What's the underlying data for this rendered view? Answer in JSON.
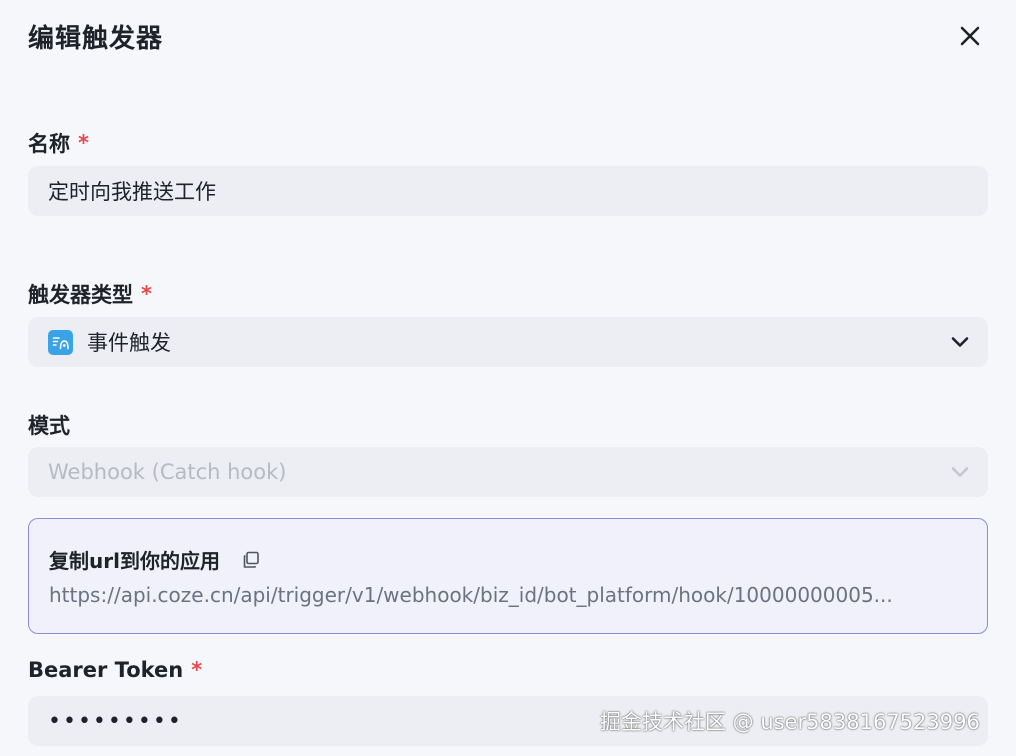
{
  "dialog": {
    "title": "编辑触发器"
  },
  "name_field": {
    "label": "名称",
    "required_mark": "*",
    "value": "定时向我推送工作"
  },
  "trigger_type": {
    "label": "触发器类型",
    "required_mark": "*",
    "value": "事件触发",
    "icon": "event-trigger-icon"
  },
  "mode": {
    "label": "模式",
    "value": "Webhook (Catch hook)"
  },
  "webhook": {
    "title": "复制url到你的应用",
    "url": "https://api.coze.cn/api/trigger/v1/webhook/biz_id/bot_platform/hook/10000000005..."
  },
  "bearer_token": {
    "label": "Bearer Token",
    "required_mark": "*",
    "value": "•••••••••"
  },
  "watermark": "掘金技术社区 @ user5838167523996",
  "colors": {
    "accent_border": "#8b8fd6",
    "required": "#e5484d",
    "field_bg": "#eceef3",
    "page_bg": "#f6f7fb"
  }
}
